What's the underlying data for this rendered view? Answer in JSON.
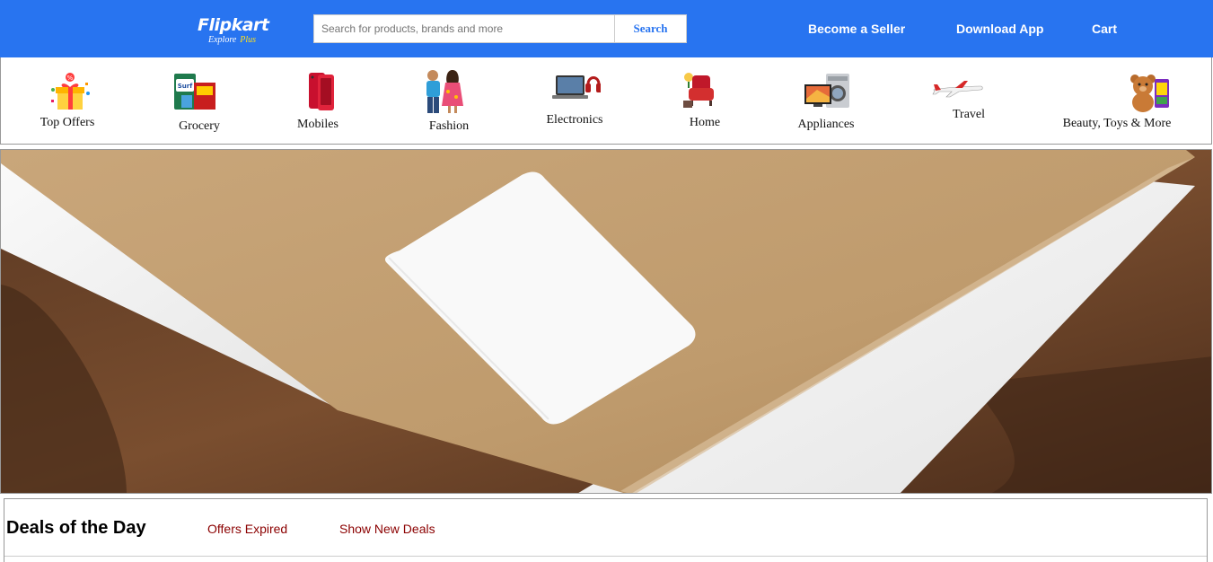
{
  "header": {
    "logo": {
      "name": "Flipkart",
      "tagline": "Explore",
      "tagline_plus": "Plus"
    },
    "search": {
      "placeholder": "Search for products, brands and more",
      "value": "",
      "button_label": "Search"
    },
    "nav": [
      {
        "label": "Become a Seller"
      },
      {
        "label": "Download App"
      },
      {
        "label": "Cart"
      }
    ]
  },
  "categories": [
    {
      "label": "Top Offers",
      "icon": "gift-icon"
    },
    {
      "label": "Grocery",
      "icon": "grocery-icon"
    },
    {
      "label": "Mobiles",
      "icon": "mobile-phone-icon"
    },
    {
      "label": "Fashion",
      "icon": "fashion-icon"
    },
    {
      "label": "Electronics",
      "icon": "laptop-icon"
    },
    {
      "label": "Home",
      "icon": "armchair-icon"
    },
    {
      "label": "Appliances",
      "icon": "appliances-icon"
    },
    {
      "label": "Travel",
      "icon": "airplane-icon"
    },
    {
      "label": "Beauty, Toys & More",
      "icon": "teddy-bear-icon"
    }
  ],
  "banner": {
    "image": "envelope-photo"
  },
  "deals": {
    "title": "Deals of the Day",
    "status": "Offers Expired",
    "link": "Show New Deals"
  },
  "colors": {
    "brand": "#2874f0",
    "deal_link": "#8b0000",
    "logo_plus": "#ffe11b"
  }
}
